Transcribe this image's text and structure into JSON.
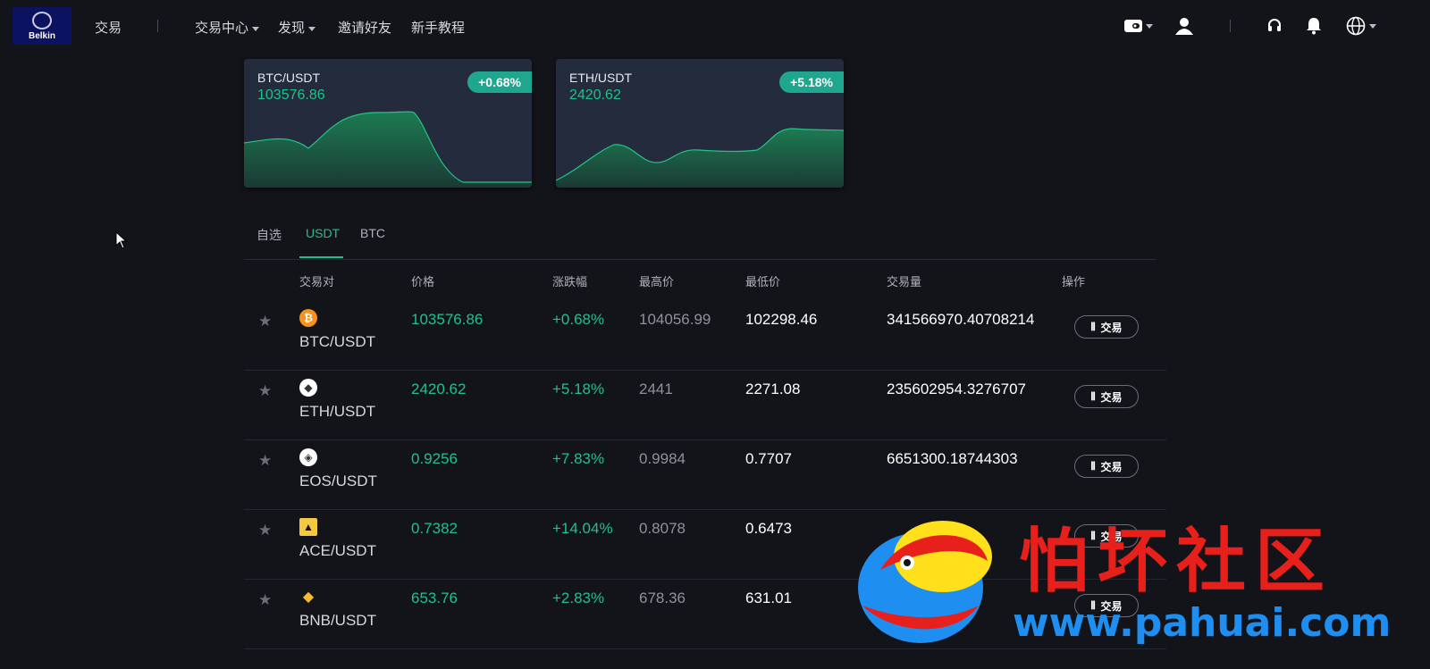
{
  "nav": {
    "logo_text": "Belkin",
    "trade": "交易",
    "trade_center": "交易中心",
    "discover": "发现",
    "invite": "邀请好友",
    "tutorial": "新手教程"
  },
  "cards": [
    {
      "pair": "BTC/USDT",
      "price": "103576.86",
      "change": "+0.68%"
    },
    {
      "pair": "ETH/USDT",
      "price": "2420.62",
      "change": "+5.18%"
    }
  ],
  "tabs": [
    "自选",
    "USDT",
    "BTC"
  ],
  "active_tab": "USDT",
  "table": {
    "headers": [
      "交易对",
      "价格",
      "涨跌幅",
      "最高价",
      "最低价",
      "交易量",
      "操作"
    ],
    "trade_label": "交易",
    "rows": [
      {
        "pair": "BTC/USDT",
        "price": "103576.86",
        "change": "+0.68%",
        "high": "104056.99",
        "low": "102298.46",
        "volume": "341566970.40708214",
        "icon": "bitcoin-icon"
      },
      {
        "pair": "ETH/USDT",
        "price": "2420.62",
        "change": "+5.18%",
        "high": "2441",
        "low": "2271.08",
        "volume": "235602954.3276707",
        "icon": "ethereum-icon"
      },
      {
        "pair": "EOS/USDT",
        "price": "0.9256",
        "change": "+7.83%",
        "high": "0.9984",
        "low": "0.7707",
        "volume": "6651300.18744303",
        "icon": "eos-icon"
      },
      {
        "pair": "ACE/USDT",
        "price": "0.7382",
        "change": "+14.04%",
        "high": "0.8078",
        "low": "0.6473",
        "volume": "",
        "icon": "ace-icon"
      },
      {
        "pair": "BNB/USDT",
        "price": "653.76",
        "change": "+2.83%",
        "high": "678.36",
        "low": "631.01",
        "volume": "",
        "icon": "bnb-icon"
      }
    ]
  },
  "watermark": {
    "title": "怕坏社区",
    "url": "www.pahuai.com"
  },
  "colors": {
    "up_green": "#22c08a",
    "badge_teal": "#1fa68e",
    "card_bg": "#242b3c",
    "page_bg": "#131419",
    "watermark_red": "#e8201c",
    "watermark_blue": "#1e8ef0"
  }
}
